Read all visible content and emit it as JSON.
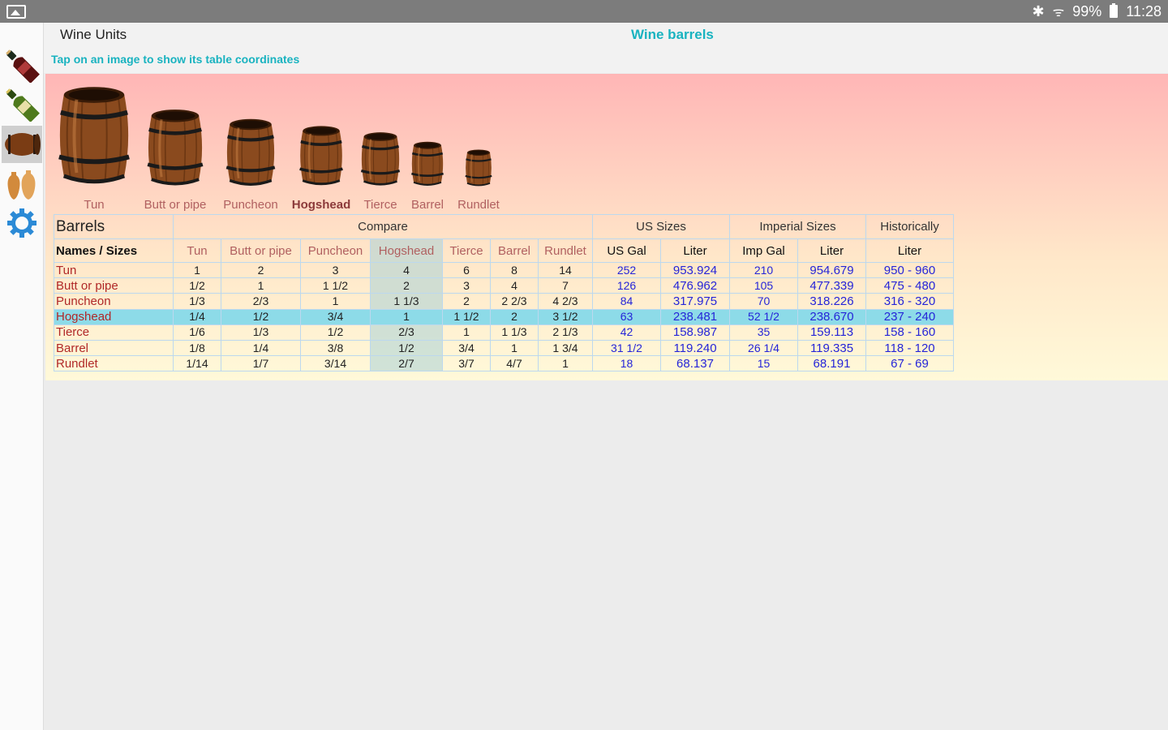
{
  "status_bar": {
    "battery": "99%",
    "time": "11:28"
  },
  "header": {
    "app_title": "Wine Units",
    "page_title": "Wine barrels",
    "hint": "Tap on an image to show its table coordinates"
  },
  "sidebar": {
    "tools": [
      {
        "name": "red-wine-bottle-icon"
      },
      {
        "name": "white-wine-bottle-icon"
      },
      {
        "name": "barrel-icon",
        "active": true
      },
      {
        "name": "amphora-icon"
      },
      {
        "name": "settings-gear-icon"
      }
    ]
  },
  "barrels": [
    {
      "label": "Tun"
    },
    {
      "label": "Butt or pipe"
    },
    {
      "label": "Puncheon"
    },
    {
      "label": "Hogshead",
      "selected": true
    },
    {
      "label": "Tierce"
    },
    {
      "label": "Barrel"
    },
    {
      "label": "Rundlet"
    }
  ],
  "table": {
    "corner": "Barrels",
    "groups": {
      "compare": "Compare",
      "us": "US Sizes",
      "imperial": "Imperial Sizes",
      "hist": "Historically"
    },
    "names_header": "Names / Sizes",
    "cols": [
      "Tun",
      "Butt or pipe",
      "Puncheon",
      "Hogshead",
      "Tierce",
      "Barrel",
      "Rundlet"
    ],
    "unit_cols": [
      "US Gal",
      "Liter",
      "Imp Gal",
      "Liter",
      "Liter"
    ],
    "rows": [
      {
        "name": "Tun",
        "cmp": [
          "1",
          "2",
          "3",
          "4",
          "6",
          "8",
          "14"
        ],
        "us_gal": "252",
        "us_l": "953.924",
        "imp_gal": "210",
        "imp_l": "954.679",
        "hist": "950 - 960"
      },
      {
        "name": "Butt or pipe",
        "cmp": [
          "1/2",
          "1",
          "1 1/2",
          "2",
          "3",
          "4",
          "7"
        ],
        "us_gal": "126",
        "us_l": "476.962",
        "imp_gal": "105",
        "imp_l": "477.339",
        "hist": "475 - 480"
      },
      {
        "name": "Puncheon",
        "cmp": [
          "1/3",
          "2/3",
          "1",
          "1 1/3",
          "2",
          "2 2/3",
          "4 2/3"
        ],
        "us_gal": "84",
        "us_l": "317.975",
        "imp_gal": "70",
        "imp_l": "318.226",
        "hist": "316 - 320"
      },
      {
        "name": "Hogshead",
        "cmp": [
          "1/4",
          "1/2",
          "3/4",
          "1",
          "1 1/2",
          "2",
          "3 1/2"
        ],
        "us_gal": "63",
        "us_l": "238.481",
        "imp_gal": "52 1/2",
        "imp_l": "238.670",
        "hist": "237 - 240"
      },
      {
        "name": "Tierce",
        "cmp": [
          "1/6",
          "1/3",
          "1/2",
          "2/3",
          "1",
          "1 1/3",
          "2 1/3"
        ],
        "us_gal": "42",
        "us_l": "158.987",
        "imp_gal": "35",
        "imp_l": "159.113",
        "hist": "158 - 160"
      },
      {
        "name": "Barrel",
        "cmp": [
          "1/8",
          "1/4",
          "3/8",
          "1/2",
          "3/4",
          "1",
          "1 3/4"
        ],
        "us_gal": "31 1/2",
        "us_l": "119.240",
        "imp_gal": "26 1/4",
        "imp_l": "119.335",
        "hist": "118 - 120"
      },
      {
        "name": "Rundlet",
        "cmp": [
          "1/14",
          "1/7",
          "3/14",
          "2/7",
          "3/7",
          "4/7",
          "1"
        ],
        "us_gal": "18",
        "us_l": "68.137",
        "imp_gal": "15",
        "imp_l": "68.191",
        "hist": "67 - 69"
      }
    ]
  }
}
